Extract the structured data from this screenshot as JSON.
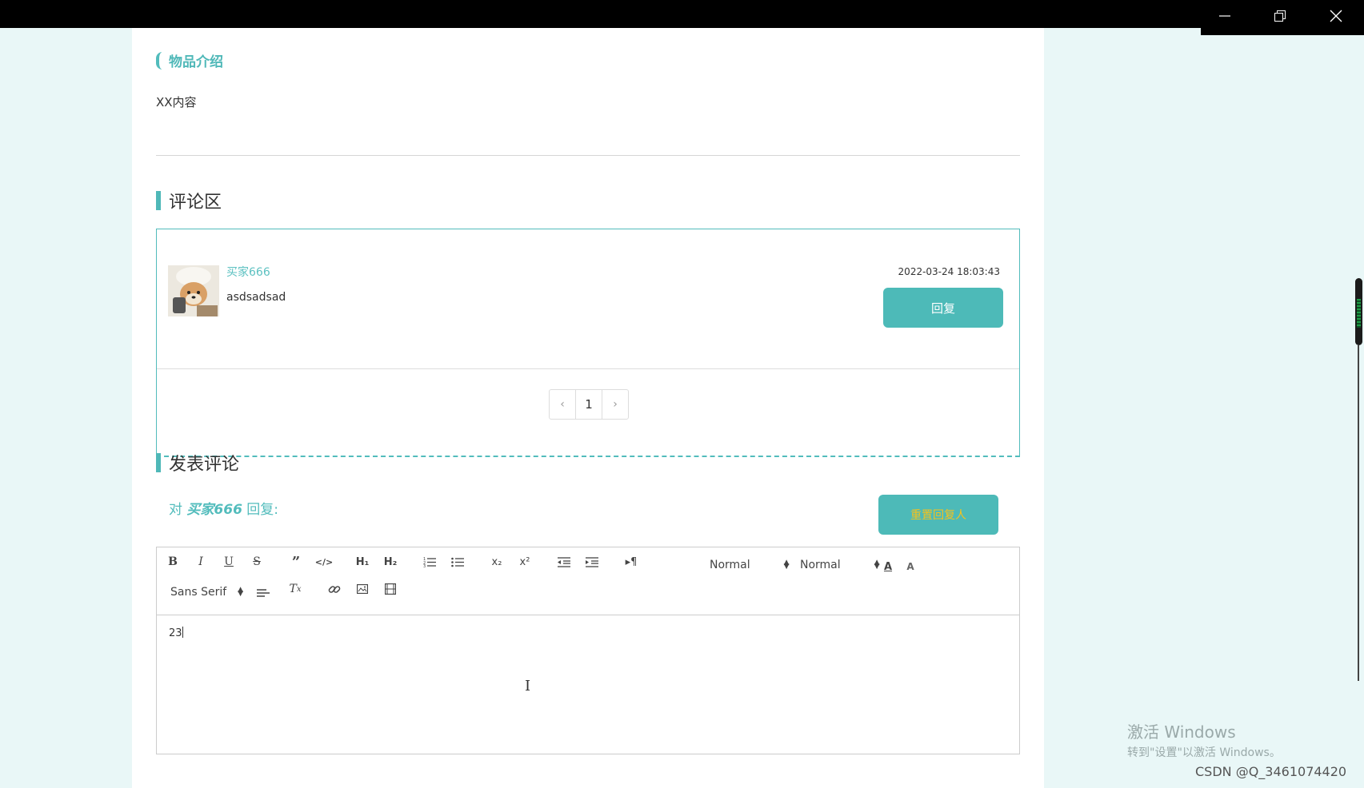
{
  "window": {
    "minimize_icon": "minimize-icon",
    "restore_icon": "restore-icon",
    "close_icon": "close-icon"
  },
  "intro": {
    "title": "物品介绍",
    "content": "XX内容"
  },
  "comments": {
    "heading": "评论区",
    "items": [
      {
        "user": "买家666",
        "text": "asdsadsad",
        "time": "2022-03-24 18:03:43",
        "reply_label": "回复"
      }
    ],
    "pagination": {
      "prev": "‹",
      "current": "1",
      "next": "›"
    }
  },
  "post": {
    "heading": "发表评论",
    "reply_prefix": "对 ",
    "reply_name": "买家666",
    "reply_suffix": " 回复:",
    "reset_label": "重置回复人",
    "editor": {
      "header_select": "Normal",
      "size_select": "Normal",
      "font_select": "Sans Serif",
      "content": "23"
    }
  },
  "overlay": {
    "activate_title": "激活 Windows",
    "activate_sub": "转到\"设置\"以激活 Windows。",
    "csdn": "CSDN @Q_3461074420"
  },
  "colors": {
    "accent": "#4fb8b8",
    "reset_text": "#f7c21a",
    "page_bg": "#e9f7f7"
  }
}
